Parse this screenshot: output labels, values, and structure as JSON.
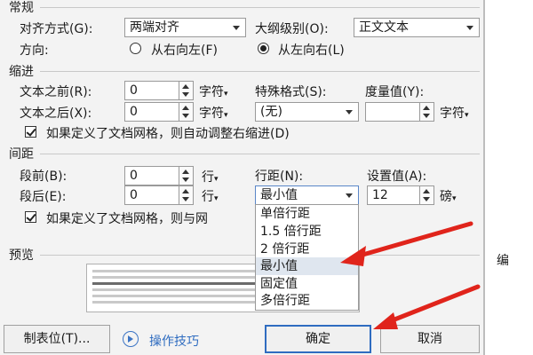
{
  "sections": {
    "general": "常规",
    "indent": "缩进",
    "spacing": "间距",
    "preview": "预览"
  },
  "general": {
    "alignment_label": "对齐方式(G):",
    "alignment_value": "两端对齐",
    "outline_label": "大纲级别(O):",
    "outline_value": "正文文本",
    "direction_label": "方向:",
    "rtl_label": "从右向左(F)",
    "ltr_label": "从左向右(L)",
    "direction_selected": "从左向右(L)"
  },
  "indent": {
    "before_label": "文本之前(R):",
    "before_value": "0",
    "before_unit": "字符",
    "after_label": "文本之后(X):",
    "after_value": "0",
    "after_unit": "字符",
    "special_label": "特殊格式(S):",
    "special_value": "(无)",
    "measure_label": "度量值(Y):",
    "measure_value": "",
    "measure_unit": "字符",
    "auto_adjust_label": "如果定义了文档网格，则自动调整右缩进(D)",
    "auto_adjust_checked": true
  },
  "spacing": {
    "before_label": "段前(B):",
    "before_value": "0",
    "before_unit": "行",
    "after_label": "段后(E):",
    "after_value": "0",
    "after_unit": "行",
    "line_label": "行距(N):",
    "line_value": "最小值",
    "setting_label": "设置值(A):",
    "setting_value": "12",
    "setting_unit": "磅",
    "grid_label": "如果定义了文档网格，则与网",
    "grid_checked": true,
    "line_options": [
      "单倍行距",
      "1.5 倍行距",
      "2 倍行距",
      "最小值",
      "固定值",
      "多倍行距"
    ],
    "line_options_selected": "最小值"
  },
  "buttons": {
    "tabs": "制表位(T)...",
    "tips": "操作技巧",
    "ok": "确定",
    "cancel": "取消"
  },
  "side_text": "编",
  "colors": {
    "arrow": "#e0241b",
    "accent": "#2f6cc0",
    "selection": "#dfe6ef"
  }
}
